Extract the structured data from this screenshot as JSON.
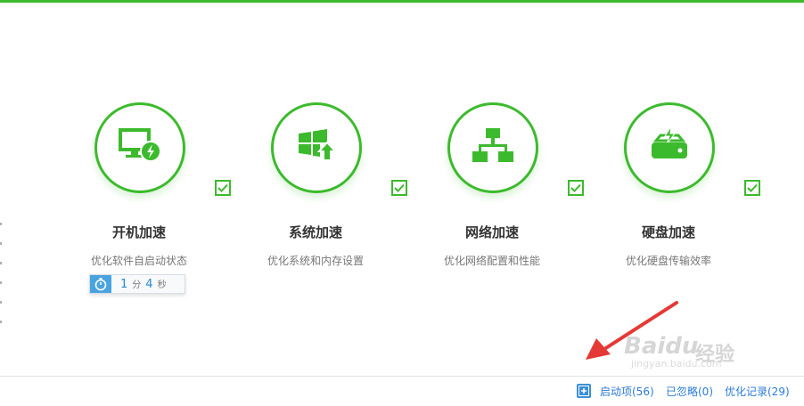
{
  "features": [
    {
      "title": "开机加速",
      "desc": "优化软件自启动状态",
      "icon": "monitor-bolt-icon"
    },
    {
      "title": "系统加速",
      "desc": "优化系统和内存设置",
      "icon": "windows-up-icon"
    },
    {
      "title": "网络加速",
      "desc": "优化网络配置和性能",
      "icon": "network-icon"
    },
    {
      "title": "硬盘加速",
      "desc": "优化硬盘传输效率",
      "icon": "harddisk-bolt-icon"
    }
  ],
  "timer": {
    "minutes": "1",
    "minutes_unit": "分",
    "seconds": "4",
    "seconds_unit": "秒"
  },
  "bottom": {
    "startup": "启动项(56)",
    "ignored": "已忽略(0)",
    "history": "优化记录(29)"
  },
  "watermark": {
    "brand": "Baidu",
    "text": "经验",
    "url": "jingyan.baidu.com"
  },
  "colors": {
    "accent": "#3cba2d",
    "link": "#2b7bd6",
    "timer": "#4aa3e0",
    "arrow": "#e53935"
  }
}
